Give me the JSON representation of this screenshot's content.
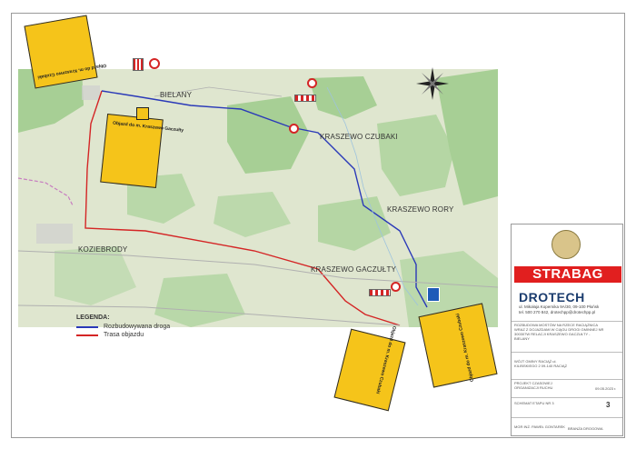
{
  "places": {
    "bielany": "BIELANY",
    "czubaki": "KRASZEWO CZUBAKI",
    "rory": "KRASZEWO RORY",
    "koziebrody": "KOZIEBRODY",
    "gaczulty": "KRASZEWO GACZUŁTY"
  },
  "legend": {
    "title": "LEGENDA:",
    "items": [
      {
        "label": "Rozbudowywana droga",
        "color": "#2a39b8"
      },
      {
        "label": "Trasa objazdu",
        "color": "#d42525"
      }
    ]
  },
  "signs": {
    "topleft": "Objazd do m. Kraszewo Czubaki",
    "mid": "Objazd do m. Kraszewo Gaczułty",
    "bottom": "Objazd do m. Kraszewo Czubaki",
    "right": "Objazd do m. Kraszewo Czubaki"
  },
  "titleblock": {
    "brand1": "STRABAG",
    "brand2": "DROTECH",
    "address": "ul. Mikołaja Kopernika 9A/30, 09-100 Płońsk",
    "contact": "tel. 500 270 842, drotechpp@drotechpp.pl",
    "project": "ROZBUDOWA MOSTÓW NA RZECE RACIĄŻNICA WRAZ Z DOJAZDAMI W CIĄGU DROGI GMINNEJ NR 300307W RELACJI KRASZEWO GACZUŁTY - BIELANY",
    "investor": "WÓJT GMINY RACIĄŻ ul. KILIŃSKIEGO 2 09-140 RACIĄŻ",
    "stage": "PROJEKT CZASOWEJ ORGANIZACJI RUCHU",
    "drawing": "SCHEMAT ETAPU NR 3",
    "date": "09.05.2023 r.",
    "sheet": "3",
    "designer": "MGR INŻ. PAWEŁ GONTAREK",
    "role": "BRANŻA DROGOWA"
  },
  "map_colors": {
    "background": "#dfe6cf",
    "forest": "#a7cf95",
    "detour": "#d42525",
    "road": "#2a39b8",
    "boundary": "#c77ec0"
  }
}
